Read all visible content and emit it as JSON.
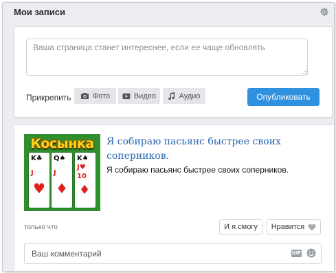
{
  "header": {
    "title": "Мои записи",
    "settings_icon": "gear-icon"
  },
  "composer": {
    "placeholder": "Ваша страница станет интереснее, если ее чаще обновлять",
    "attach_label": "Прикрепить",
    "attach_buttons": [
      {
        "label": "Фото",
        "icon": "camera-icon"
      },
      {
        "label": "Видео",
        "icon": "video-icon"
      },
      {
        "label": "Аудио",
        "icon": "music-note-icon"
      }
    ],
    "publish_label": "Опубликовать"
  },
  "post": {
    "thumbnail": {
      "title": "Косынка",
      "cards": [
        {
          "ranks": [
            "K",
            "J"
          ],
          "suits": [
            "♣",
            "♥"
          ]
        },
        {
          "ranks": [
            "Q",
            "J"
          ],
          "suits": [
            "♠",
            "♦"
          ]
        },
        {
          "ranks": [
            "K",
            "J",
            "10"
          ],
          "suits": [
            "♠",
            "♥",
            "♦"
          ]
        }
      ]
    },
    "title": "Я собираю пасьянс быстрее своих соперников.",
    "description": "Я собираю пасьянс быстрее своих соперников.",
    "meta": "только что",
    "me_too_label": "И я смогу",
    "like_label": "Нравится",
    "comment_placeholder": "Ваш комментарий",
    "gif_label": "GIF"
  },
  "colors": {
    "accent": "#2e90de",
    "link": "#2a68b3",
    "background": "#ebedf0"
  }
}
